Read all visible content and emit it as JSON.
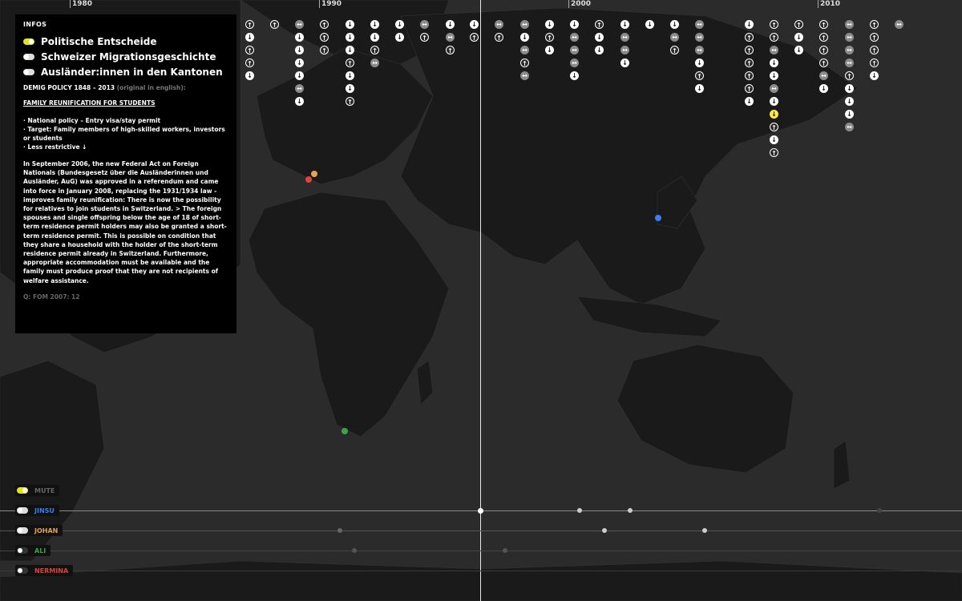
{
  "timeline": {
    "years": [
      "1980",
      "1990",
      "2000",
      "2010"
    ]
  },
  "policy_icons": {
    "legend": {
      "up": "↑",
      "down": "↓",
      "both": "↔"
    },
    "columns": [
      [
        "up",
        "down",
        "up",
        "up",
        "down"
      ],
      [
        "up"
      ],
      [
        "both",
        "down",
        "down",
        "down",
        "down",
        "both",
        "down"
      ],
      [
        "up",
        "up",
        "up"
      ],
      [
        "down",
        "down",
        "down",
        "up",
        "down",
        "down",
        "up"
      ],
      [
        "down",
        "down",
        "up",
        "both"
      ],
      [
        "down",
        "down"
      ],
      [
        "both",
        "up"
      ],
      [
        "down",
        "both",
        "up"
      ],
      [
        "down",
        "up"
      ],
      [
        "both",
        "up"
      ],
      [
        "both",
        "down",
        "both",
        "up",
        "both"
      ],
      [
        "down",
        "up",
        "down"
      ],
      [
        "down",
        "both",
        "both",
        "both",
        "down"
      ],
      [
        "up",
        "down",
        "down"
      ],
      [
        "down",
        "both",
        "both",
        "down"
      ],
      [
        "down"
      ],
      [
        "down",
        "both",
        "up"
      ],
      [
        "both",
        "both",
        "both",
        "down",
        "up",
        "down"
      ],
      [
        "down",
        "up",
        "up",
        "up",
        "up",
        "up",
        "down"
      ],
      [
        "up",
        "up",
        "both",
        "down",
        "down",
        "both",
        "down",
        "highlight",
        "up",
        "down",
        "up"
      ],
      [
        "up",
        "down",
        "down"
      ],
      [
        "up",
        "up",
        "up",
        "up",
        "both",
        "down"
      ],
      [
        "both",
        "both",
        "both",
        "both",
        "up",
        "down",
        "down",
        "down",
        "both"
      ],
      [
        "up",
        "up",
        "up",
        "up",
        "down"
      ],
      [
        "both"
      ]
    ]
  },
  "info": {
    "heading": "INFOS",
    "toggles": [
      {
        "label": "Politische Entscheide",
        "state": "on"
      },
      {
        "label": "Schweizer Migrationsgeschichte",
        "state": "off"
      },
      {
        "label": "Ausländer:innen in den Kantonen",
        "state": "off"
      }
    ],
    "subtitle": "DEMIG POLICY 1848 – 2013",
    "subtitle_note": "(original in english):",
    "policy_title": "FAMILY REUNIFICATION FOR STUDENTS",
    "bullet_1": "· National policy – Entry visa/stay permit",
    "bullet_2": "· Target: Family members of high-skilled workers, investors or students",
    "bullet_3": "· Less restrictive ↓",
    "paragraph": "In September 2006, the new Federal Act on Foreign Nationals (Bundesgesetz über die Ausländerinnen und Ausländer, AuG) was approved in a referendum and came into force in January 2008, replacing the 1931/1934 law - improves family reunification: There is now the possibility for relatives to join students in Switzerland. > The foreign spouses and single offspring below the age of 18 of short-term residence permit holders may also be granted a short-term residence permit. This is possible on condition that they share a household with the holder of the short-term residence permit already in Switzerland. Furthermore, appropriate accommodation must be available and the family must produce proof that they are not recipients of welfare assistance.",
    "source": "Q: FOM 2007: 12"
  },
  "people": [
    {
      "name": "MUTE",
      "color": "#666666",
      "toggle": "on"
    },
    {
      "name": "JINSU",
      "color": "#3a7ff0",
      "toggle": "off"
    },
    {
      "name": "JOHAN",
      "color": "#e3a35a",
      "toggle": "off"
    },
    {
      "name": "ALI",
      "color": "#3ca34a",
      "toggle": "dark"
    },
    {
      "name": "NERMINA",
      "color": "#e0423f",
      "toggle": "dark"
    }
  ],
  "colors": {
    "background": "#2b2b2b",
    "land": "#1b1b1b",
    "accent_yellow": "#ffe84a",
    "jinsu": "#3a7ff0",
    "johan": "#e3a35a",
    "ali": "#3ca34a",
    "nermina": "#e0423f"
  }
}
